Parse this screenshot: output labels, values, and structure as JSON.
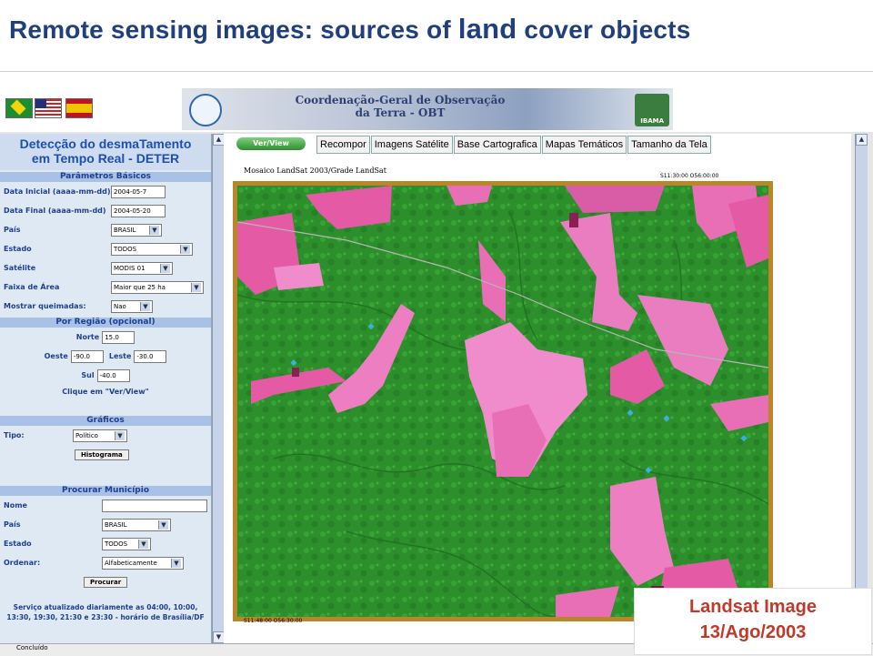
{
  "slide": {
    "title_part1": "Remote sensing images: sources of",
    "title_part2": "land",
    "title_part3": "cover objects"
  },
  "banner": {
    "title_line1": "Coordenação-Geral de Observação",
    "title_line2": "da Terra - OBT",
    "partner_logo_label": "IBAMA"
  },
  "sidebar": {
    "title_line1": "Detecção do desmaTamento",
    "title_line2": "em Tempo Real - DETER",
    "params_header": "Parâmetros Básicos",
    "fields": [
      {
        "label": "Data Inicial (aaaa-mm-dd)",
        "value": "2004-05-7"
      },
      {
        "label": "Data Final (aaaa-mm-dd)",
        "value": "2004-05-20"
      },
      {
        "label": "País",
        "value": "BRASIL"
      },
      {
        "label": "Estado",
        "value": "TODOS"
      },
      {
        "label": "Satélite",
        "value": "MODIS 01"
      },
      {
        "label": "Faixa de Área",
        "value": "Maior que 25 ha"
      },
      {
        "label": "Mostrar queimadas:",
        "value": "Nao"
      }
    ],
    "region_header": "Por Região (opcional)",
    "norte_label": "Norte",
    "norte_value": "15.0",
    "oeste_label": "Oeste",
    "oeste_value": "-90.0",
    "leste_label": "Leste",
    "leste_value": "-30.0",
    "sul_label": "Sul",
    "sul_value": "-40.0",
    "click_hint": "Clique em \"Ver/View\"",
    "graphs_header": "Gráficos",
    "tipo_label": "Tipo:",
    "tipo_value": "Político",
    "histogram_button": "Histograma",
    "muni_header": "Procurar Município",
    "nome_label": "Nome",
    "muni_pais_label": "País",
    "muni_pais_value": "BRASIL",
    "muni_estado_label": "Estado",
    "muni_estado_value": "TODOS",
    "ordenar_label": "Ordenar:",
    "ordenar_value": "Alfabeticamente",
    "procurar_button": "Procurar",
    "footer_note": "Serviço atualizado diariamente as 04:00, 10:00, 13:30, 19:30, 21:30 e 23:30 - horário de Brasília/DF"
  },
  "main": {
    "verview_button": "Ver/View",
    "tabs": [
      "Recompor",
      "Imagens Satélite",
      "Base Cartografica",
      "Mapas Temáticos",
      "Tamanho da Tela"
    ],
    "map_caption": "Mosaico LandSat 2003/Grade LandSat",
    "coord_ne": "S11:30:00 O56:00:00",
    "coord_sw": "S11:48:00 O56:30:00"
  },
  "status_text": "Concluído",
  "image_caption": {
    "line1": "Landsat Image",
    "line2": "13/Ago/2003"
  },
  "colors": {
    "title_blue": "#1f3f7f",
    "caption_red": "#c0392b",
    "forest_green": "#2d8f2b",
    "deforestation_pink": "#e86fb6",
    "frame_gold": "#b9862a"
  }
}
